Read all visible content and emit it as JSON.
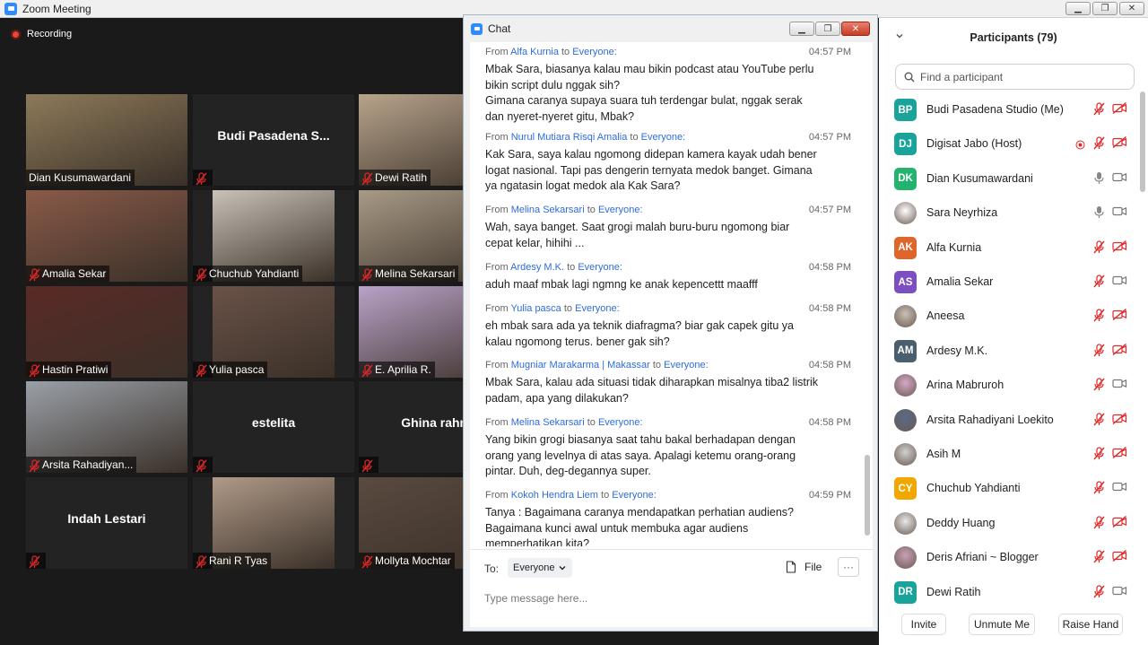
{
  "window": {
    "title": "Zoom Meeting"
  },
  "recording": {
    "label": "Recording"
  },
  "video_tiles": [
    {
      "name": "Dian Kusumawardani",
      "muted": false,
      "photo": "#8d7a5a"
    },
    {
      "name": "",
      "center": "Budi Pasadena S...",
      "muted": true
    },
    {
      "name": "Dewi Ratih",
      "muted": true,
      "photo": "#b8a48c"
    },
    {
      "name": "Amalia Sekar",
      "muted": true,
      "photo": "#8a5a48"
    },
    {
      "name": "Chuchub Yahdianti",
      "muted": true,
      "photo": "#c9c2b8"
    },
    {
      "name": "Melina Sekarsari",
      "muted": true,
      "photo": "#a89a86"
    },
    {
      "name": "Hastin Pratiwi",
      "muted": true,
      "photo": "#5a2a26"
    },
    {
      "name": "Yulia pasca",
      "muted": true,
      "photo": "#6a5248"
    },
    {
      "name": "E. Aprilia R.",
      "muted": true,
      "photo": "#b9a2c8"
    },
    {
      "name": "Arsita Rahadiyan...",
      "muted": true,
      "photo": "#9aa0a8"
    },
    {
      "name": "",
      "center": "estelita",
      "muted": true
    },
    {
      "name": "",
      "center": "Ghina rahma",
      "muted": true
    },
    {
      "name": "",
      "center": "Indah Lestari",
      "muted": true
    },
    {
      "name": "Rani R Tyas",
      "muted": true,
      "photo": "#b09a88"
    },
    {
      "name": "Mollyta Mochtar",
      "muted": true,
      "photo": "#5a4a40"
    }
  ],
  "chat": {
    "title": "Chat",
    "messages": [
      {
        "from": "Alfa Kurnia",
        "to": "Everyone:",
        "time": "04:57 PM",
        "lines": [
          "Mbak Sara, biasanya kalau mau bikin podcast atau YouTube perlu",
          "bikin script dulu nggak sih?",
          "Gimana caranya supaya suara tuh terdengar bulat, nggak serak",
          "dan nyeret-nyeret gitu, Mbak?"
        ]
      },
      {
        "from": "Nurul Mutiara Risqi Amalia",
        "to": "Everyone:",
        "time": "04:57 PM",
        "lines": [
          "Kak Sara, saya kalau ngomong didepan kamera kayak udah bener",
          "logat nasional. Tapi pas dengerin ternyata medok banget. Gimana",
          "ya ngatasin logat medok ala Kak Sara?"
        ]
      },
      {
        "from": "Melina Sekarsari",
        "to": "Everyone:",
        "time": "04:57 PM",
        "lines": [
          "Wah, saya banget. Saat grogi malah buru-buru ngomong biar",
          "cepat kelar, hihihi ..."
        ]
      },
      {
        "from": "Ardesy M.K.",
        "to": "Everyone:",
        "time": "04:58 PM",
        "lines": [
          "aduh maaf mbak lagi ngmng ke anak kepencettt maafff"
        ]
      },
      {
        "from": "Yulia pasca",
        "to": "Everyone:",
        "time": "04:58 PM",
        "lines": [
          "eh mbak sara ada ya teknik diafragma? biar gak capek gitu ya",
          "kalau ngomong terus. bener gak sih?"
        ]
      },
      {
        "from": "Mugniar Marakarma | Makassar",
        "to": "Everyone:",
        "time": "04:58 PM",
        "lines": [
          "Mbak Sara, kalau ada situasi tidak diharapkan misalnya tiba2 listrik",
          "padam, apa yang dilakukan?"
        ]
      },
      {
        "from": "Melina Sekarsari",
        "to": "Everyone:",
        "time": "04:58 PM",
        "lines": [
          "Yang bikin grogi biasanya saat tahu bakal berhadapan dengan",
          "orang yang levelnya di atas saya. Apalagi ketemu orang-orang",
          "pintar. Duh, deg-degannya super."
        ]
      },
      {
        "from": "Kokoh Hendra Liem",
        "to": "Everyone:",
        "time": "04:59 PM",
        "lines": [
          "Tanya : Bagaimana caranya mendapatkan perhatian audiens?",
          "Bagaimana kunci awal untuk membuka agar audiens",
          "memperhatikan kita?"
        ]
      }
    ],
    "from_label": "From",
    "to_word": "to",
    "to_label": "To:",
    "to_value": "Everyone",
    "file_label": "File",
    "more_label": "···",
    "placeholder": "Type message here..."
  },
  "participants": {
    "title": "Participants (79)",
    "search_placeholder": "Find a participant",
    "list": [
      {
        "name": "Budi Pasadena Studio (Me)",
        "initials": "BP",
        "color": "#1aa39a",
        "mic": "muted",
        "video": "off"
      },
      {
        "name": "Digisat Jabo (Host)",
        "initials": "DJ",
        "color": "#1aa39a",
        "mic": "muted",
        "video": "off",
        "rec": true
      },
      {
        "name": "Dian Kusumawardani",
        "initials": "DK",
        "color": "#23b36f",
        "mic": "on",
        "video": "on"
      },
      {
        "name": "Sara Neyrhiza",
        "initials": "",
        "color": "#ffffff",
        "photo": true,
        "mic": "on",
        "video": "on"
      },
      {
        "name": "Alfa Kurnia",
        "initials": "AK",
        "color": "#e0652b",
        "mic": "muted",
        "video": "off"
      },
      {
        "name": "Amalia Sekar",
        "initials": "AS",
        "color": "#7b4fbf",
        "mic": "muted",
        "video": "on"
      },
      {
        "name": "Aneesa",
        "initials": "",
        "color": "#c9c0b6",
        "photo": true,
        "mic": "muted",
        "video": "off"
      },
      {
        "name": "Ardesy M.K.",
        "initials": "AM",
        "color": "#4a5f6e",
        "mic": "muted",
        "video": "off"
      },
      {
        "name": "Arina Mabruroh",
        "initials": "",
        "color": "#d4a8c8",
        "photo": true,
        "mic": "muted",
        "video": "on"
      },
      {
        "name": "Arsita Rahadiyani Loekito",
        "initials": "",
        "color": "#5a6a8a",
        "photo": true,
        "mic": "muted",
        "video": "off"
      },
      {
        "name": "Asih M",
        "initials": "",
        "color": "#d0d0d0",
        "photo": true,
        "mic": "muted",
        "video": "off"
      },
      {
        "name": "Chuchub Yahdianti",
        "initials": "CY",
        "color": "#f0a800",
        "mic": "muted",
        "video": "on"
      },
      {
        "name": "Deddy Huang",
        "initials": "",
        "color": "#e8e8e8",
        "photo": true,
        "mic": "muted",
        "video": "off"
      },
      {
        "name": "Deris Afriani ~ Blogger",
        "initials": "",
        "color": "#c8a0b8",
        "photo": true,
        "mic": "muted",
        "video": "off"
      },
      {
        "name": "Dewi Ratih",
        "initials": "DR",
        "color": "#1aa39a",
        "mic": "muted",
        "video": "on"
      }
    ],
    "buttons": {
      "invite": "Invite",
      "unmute": "Unmute Me",
      "raise": "Raise Hand"
    }
  }
}
